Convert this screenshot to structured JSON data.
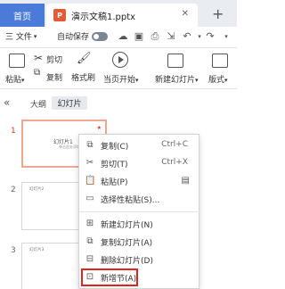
{
  "tabs": {
    "home": "首页",
    "document": "演示文稿1.pptx",
    "document_icon": "P"
  },
  "quickbar": {
    "file_menu": "三 文件",
    "autosave_label": "自动保存"
  },
  "ribbon": {
    "paste": "粘贴",
    "cut": "剪切",
    "copy": "复制",
    "format_painter": "格式刷",
    "start_from_current": "当页开始",
    "new_slide": "新建幻灯片",
    "layout": "版式"
  },
  "panel": {
    "outline_tab": "大纲",
    "slides_tab": "幻灯片",
    "slides": [
      {
        "number": "1",
        "title": "幻灯片1",
        "subtitle": "单击此处添加副标题"
      },
      {
        "number": "2",
        "title": "幻灯片2"
      },
      {
        "number": "3",
        "title": "幻灯片3"
      }
    ]
  },
  "context_menu": {
    "items": [
      {
        "label": "复制(C)",
        "shortcut": "Ctrl+C",
        "icon": "copy-icon"
      },
      {
        "label": "剪切(T)",
        "shortcut": "Ctrl+X",
        "icon": "scissors-icon"
      },
      {
        "label": "粘贴(P)",
        "icon": "paste-icon"
      },
      {
        "label": "选择性粘贴(S)...",
        "icon": "paste-special-icon"
      },
      {
        "label": "新建幻灯片(N)",
        "icon": "new-slide-icon"
      },
      {
        "label": "复制幻灯片(A)",
        "icon": "duplicate-slide-icon"
      },
      {
        "label": "删除幻灯片(D)",
        "icon": "delete-slide-icon"
      },
      {
        "label": "新增节(A)",
        "icon": "add-section-icon"
      }
    ],
    "highlight_color": "#e1251b"
  },
  "colors": {
    "accent": "#4a7bd8",
    "ppt_icon": "#e35c34",
    "active_slide_border": "#f0a792"
  }
}
